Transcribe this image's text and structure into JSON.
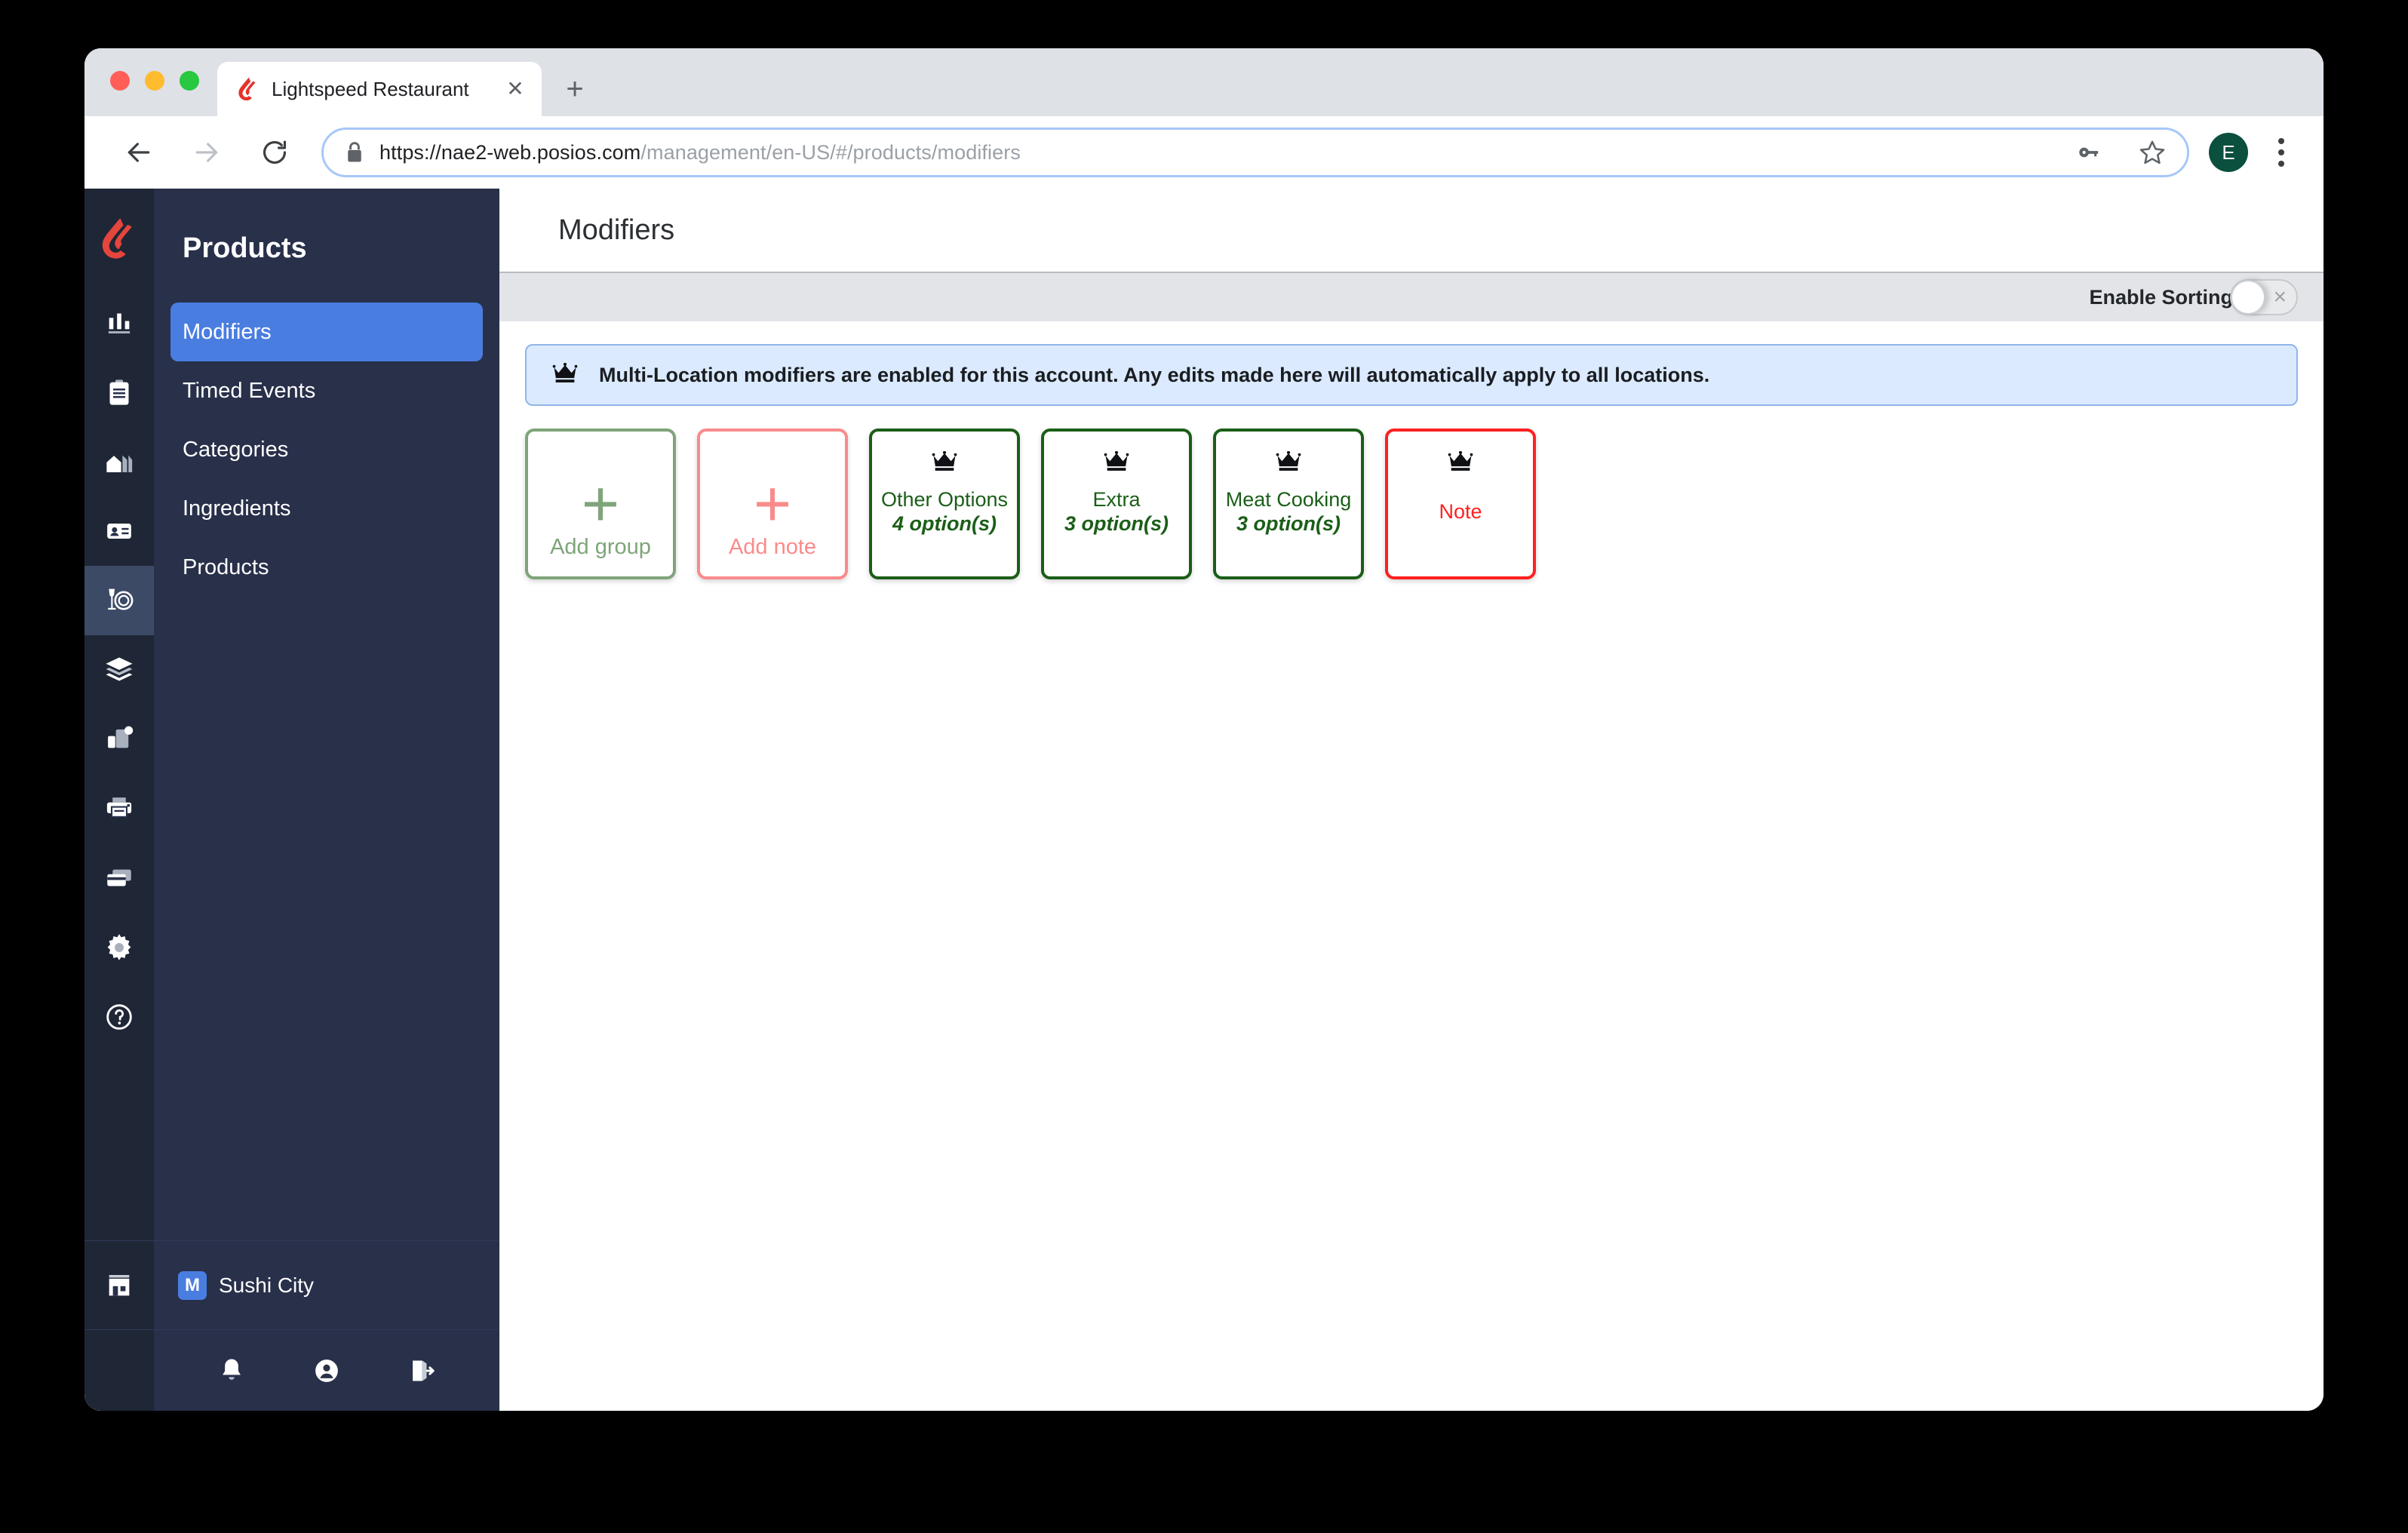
{
  "browser": {
    "tab_title": "Lightspeed Restaurant",
    "tab_favicon": "lightspeed-flame-icon",
    "close_tab_glyph": "✕",
    "new_tab_glyph": "+",
    "url_secure_part": "https://nae2-web.posios.com",
    "url_path_part": "/management/en-US/#/products/modifiers",
    "url_full": "https://nae2-web.posios.com/management/en-US/#/products/modifiers",
    "profile_initial": "E",
    "icons": {
      "back": "back-arrow-icon",
      "forward": "forward-arrow-icon",
      "reload": "reload-icon",
      "lock": "lock-icon",
      "key": "key-icon",
      "star": "star-bookmark-icon",
      "menu": "three-dot-menu-icon"
    }
  },
  "sidebar": {
    "title": "Products",
    "items": [
      {
        "label": "Modifiers",
        "active": true
      },
      {
        "label": "Timed Events",
        "active": false
      },
      {
        "label": "Categories",
        "active": false
      },
      {
        "label": "Ingredients",
        "active": false
      },
      {
        "label": "Products",
        "active": false
      }
    ],
    "rail_icons": [
      {
        "name": "reports-bar-chart-icon",
        "active": false
      },
      {
        "name": "clipboard-icon",
        "active": false
      },
      {
        "name": "venues-building-icon",
        "active": false
      },
      {
        "name": "customers-card-icon",
        "active": false
      },
      {
        "name": "products-plate-icon",
        "active": true
      },
      {
        "name": "layers-icon",
        "active": false
      },
      {
        "name": "devices-icon",
        "active": false
      },
      {
        "name": "printer-icon",
        "active": false
      },
      {
        "name": "payments-card-icon",
        "active": false
      },
      {
        "name": "settings-gear-icon",
        "active": false
      },
      {
        "name": "help-question-icon",
        "active": false
      }
    ],
    "store": {
      "icon": "store-front-icon",
      "badge": "M",
      "name": "Sushi City"
    },
    "footer_icons": [
      {
        "name": "notifications-bell-icon"
      },
      {
        "name": "account-user-icon"
      },
      {
        "name": "logout-icon"
      }
    ]
  },
  "main": {
    "page_title": "Modifiers",
    "sorting": {
      "label": "Enable Sorting",
      "enabled": false,
      "off_glyph": "×"
    },
    "banner": {
      "icon": "crown-icon",
      "text": "Multi-Location modifiers are enabled for this account. Any edits made here will automatically apply to all locations.",
      "background": "#dbeafe",
      "border": "#8fb6e8"
    },
    "cards": [
      {
        "kind": "add",
        "plus": "+",
        "label": "Add group",
        "name": "",
        "count": "",
        "style": "card-green-light",
        "color": "#7fa47a"
      },
      {
        "kind": "add",
        "plus": "+",
        "label": "Add note",
        "name": "",
        "count": "",
        "style": "card-pink",
        "color": "#fa8b8b"
      },
      {
        "kind": "group",
        "plus": "",
        "label": "",
        "name": "Other Options",
        "count": "4 option(s)",
        "style": "card-green-dark",
        "color": "#1b5e18"
      },
      {
        "kind": "group",
        "plus": "",
        "label": "",
        "name": "Extra",
        "count": "3 option(s)",
        "style": "card-green-dark",
        "color": "#1b5e18"
      },
      {
        "kind": "group",
        "plus": "",
        "label": "",
        "name": "Meat Cooking",
        "count": "3 option(s)",
        "style": "card-green-dark",
        "color": "#1b5e18"
      },
      {
        "kind": "note",
        "plus": "",
        "label": "",
        "name": "Note",
        "count": "",
        "style": "card-red",
        "color": "#ff2020"
      }
    ]
  }
}
